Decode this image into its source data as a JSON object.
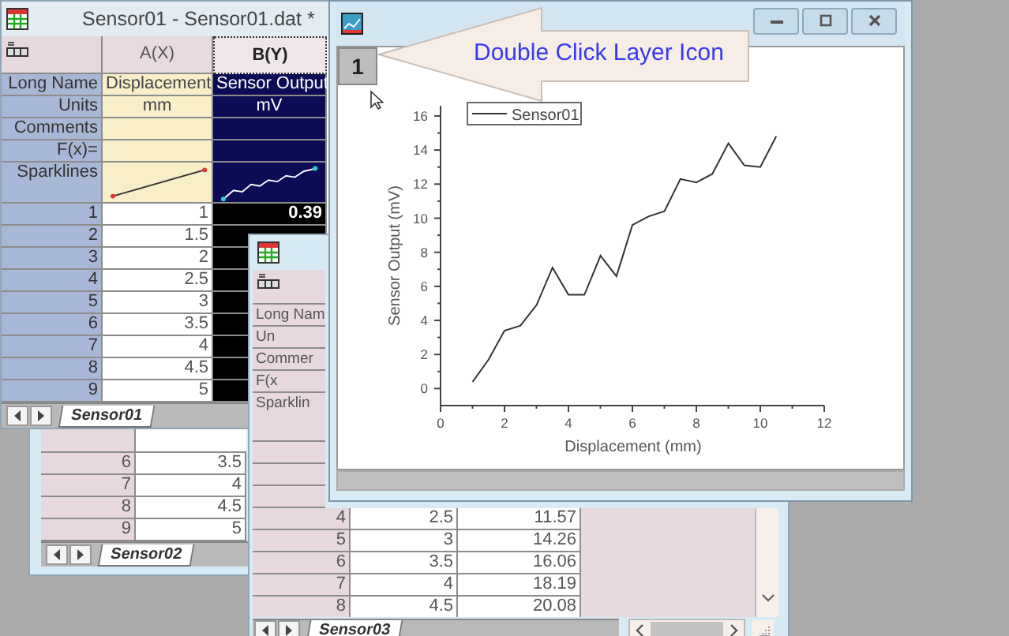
{
  "workbooks": [
    {
      "title": "Sensor01 - Sensor01.dat *",
      "sheet_tab": "Sensor01",
      "columns": [
        {
          "name": "A(X)",
          "long_name": "Displacement",
          "units": "mm",
          "selected": false
        },
        {
          "name": "B(Y)",
          "long_name": "Sensor Output",
          "units": "mV",
          "selected": true
        }
      ],
      "label_rows": [
        {
          "label": "Long Name",
          "kind": "long_name"
        },
        {
          "label": "Units",
          "kind": "units"
        },
        {
          "label": "Comments",
          "kind": "comments"
        },
        {
          "label": "F(x)=",
          "kind": "formula"
        },
        {
          "label": "Sparklines",
          "kind": "sparkline"
        }
      ],
      "rows": [
        {
          "num": "1",
          "a": "1",
          "b": "0.39"
        },
        {
          "num": "2",
          "a": "1.5"
        },
        {
          "num": "3",
          "a": "2"
        },
        {
          "num": "4",
          "a": "2.5"
        },
        {
          "num": "5",
          "a": "3"
        },
        {
          "num": "6",
          "a": "3.5"
        },
        {
          "num": "7",
          "a": "4"
        },
        {
          "num": "8",
          "a": "4.5"
        },
        {
          "num": "9",
          "a": "5"
        }
      ]
    },
    {
      "sheet_tab": "Sensor02",
      "rows": [
        {
          "num": "6",
          "a": "3.5"
        },
        {
          "num": "7",
          "a": "4"
        },
        {
          "num": "8",
          "a": "4.5"
        },
        {
          "num": "9",
          "a": "5"
        }
      ]
    },
    {
      "sheet_tab": "Sensor03",
      "label_rows": [
        {
          "label": "Long Nam",
          "kind": "long_name"
        },
        {
          "label": "Un",
          "kind": "units"
        },
        {
          "label": "Commer",
          "kind": "comments"
        },
        {
          "label": "F(x",
          "kind": "formula"
        },
        {
          "label": "Sparklin",
          "kind": "sparkline"
        }
      ],
      "rows": [
        {
          "num": "4",
          "a": "2.5",
          "b": "11.57"
        },
        {
          "num": "5",
          "a": "3",
          "b": "14.26"
        },
        {
          "num": "6",
          "a": "3.5",
          "b": "16.06"
        },
        {
          "num": "7",
          "a": "4",
          "b": "18.19"
        },
        {
          "num": "8",
          "a": "4.5",
          "b": "20.08"
        }
      ]
    }
  ],
  "graph": {
    "layer": "1",
    "callout": "Double Click Layer Icon",
    "chart_data": {
      "type": "line",
      "xlabel": "Displacement (mm)",
      "ylabel": "Sensor Output (mV)",
      "x": [
        1,
        1.5,
        2,
        2.5,
        3,
        3.5,
        4,
        4.5,
        5,
        5.5,
        6,
        6.5,
        7,
        7.5,
        8,
        8.5,
        9,
        9.5,
        10,
        10.5
      ],
      "series": [
        {
          "name": "Sensor01",
          "color": "#333333",
          "values": [
            0.4,
            1.7,
            3.4,
            3.7,
            4.9,
            7.1,
            5.5,
            5.5,
            7.8,
            6.6,
            9.6,
            10.1,
            10.4,
            12.3,
            12.1,
            12.6,
            14.4,
            13.1,
            13.0,
            14.8
          ]
        }
      ],
      "xlim": [
        0,
        12
      ],
      "ylim": [
        -1,
        16.6
      ],
      "xticks": [
        0,
        2,
        4,
        6,
        8,
        10,
        12
      ],
      "yticks": [
        0,
        2,
        4,
        6,
        8,
        10,
        12,
        14,
        16
      ]
    }
  }
}
